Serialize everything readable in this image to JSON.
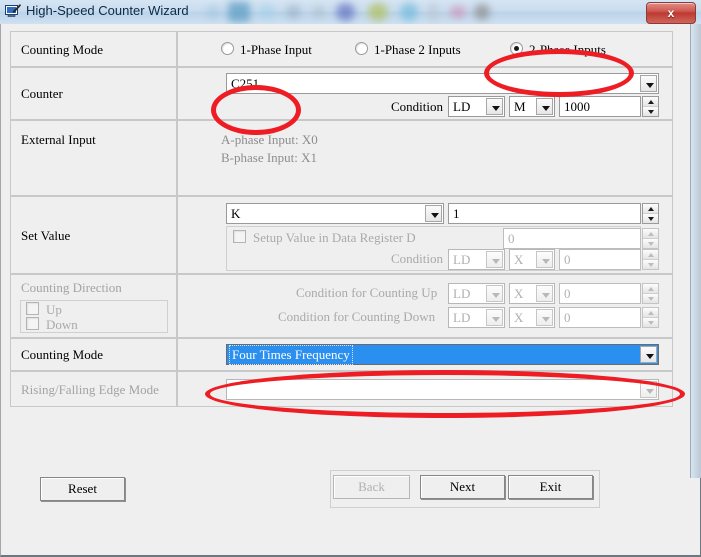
{
  "window": {
    "title": "High-Speed Counter Wizard",
    "app_icon": "counter-wizard-icon",
    "close_label": "x"
  },
  "rows": {
    "counting_mode_top": {
      "label": "Counting Mode",
      "options": [
        {
          "label": "1-Phase Input",
          "selected": false
        },
        {
          "label": "1-Phase 2 Inputs",
          "selected": false
        },
        {
          "label": "2-Phase Inputs",
          "selected": true
        }
      ]
    },
    "counter": {
      "label": "Counter",
      "device": "C251",
      "condition_label": "Condition",
      "condition_instr": "LD",
      "condition_type": "M",
      "condition_value": "1000"
    },
    "external_input": {
      "label": "External Input",
      "line_a": "A-phase Input: X0",
      "line_b": "B-phase Input: X1"
    },
    "set_value": {
      "label": "Set Value",
      "prefix": "K",
      "value": "1",
      "register_checkbox_label": "Setup Value in Data Register D",
      "register_value": "0",
      "condition_label": "Condition",
      "condition_instr": "LD",
      "condition_type": "X",
      "condition_value": "0"
    },
    "counting_direction": {
      "label": "Counting Direction",
      "up_label": "Up",
      "down_label": "Down",
      "up_cond_label": "Condition for Counting Up",
      "up_cond_instr": "LD",
      "up_cond_type": "X",
      "up_cond_value": "0",
      "down_cond_label": "Condition for Counting Down",
      "down_cond_instr": "LD",
      "down_cond_type": "X",
      "down_cond_value": "0"
    },
    "counting_mode_bottom": {
      "label": "Counting Mode",
      "value": "Four Times Frequency"
    },
    "edge_mode": {
      "label": "Rising/Falling Edge Mode",
      "value": ""
    }
  },
  "buttons": {
    "reset": "Reset",
    "back": "Back",
    "next": "Next",
    "exit": "Exit"
  },
  "colors": {
    "selection_blue": "#2a8fef",
    "annotation_red": "#ee1c23",
    "dialog_bg": "#efefef",
    "titlebar_blue": "#c9dcee"
  }
}
